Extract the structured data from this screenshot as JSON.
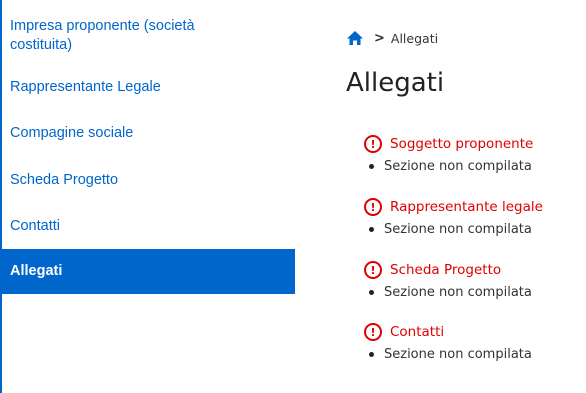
{
  "sidebar": {
    "items": [
      {
        "label_line1": "Impresa proponente (società",
        "label_line2": "costituita)"
      },
      {
        "label": "Rappresentante Legale"
      },
      {
        "label": "Compagine sociale"
      },
      {
        "label": "Scheda Progetto"
      },
      {
        "label": "Contatti"
      },
      {
        "label": "Allegati",
        "active": true
      }
    ]
  },
  "breadcrumb": {
    "home_icon": "home-icon",
    "separator": ">",
    "current": "Allegati"
  },
  "main": {
    "title": "Allegati",
    "alert_icon_glyph": "!",
    "sections": [
      {
        "title": "Soggetto proponente",
        "status": "Sezione non compilata"
      },
      {
        "title": "Rappresentante legale",
        "status": "Sezione non compilata"
      },
      {
        "title": "Scheda Progetto",
        "status": "Sezione non compilata"
      },
      {
        "title": "Contatti",
        "status": "Sezione non compilata"
      }
    ]
  },
  "colors": {
    "accent": "#0066cc",
    "error": "#e00000",
    "active_text": "#ffffff"
  }
}
